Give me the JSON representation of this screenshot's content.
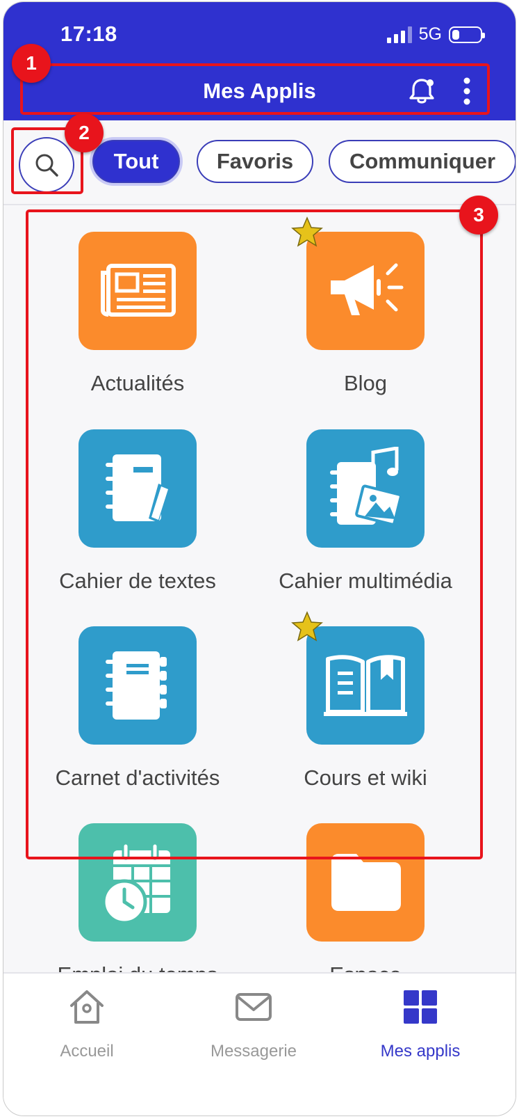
{
  "status": {
    "time": "17:18",
    "network": "5G"
  },
  "header": {
    "title": "Mes Applis"
  },
  "filters": [
    "Tout",
    "Favoris",
    "Communiquer"
  ],
  "apps": [
    {
      "label": "Actualités",
      "favorite": false
    },
    {
      "label": "Blog",
      "favorite": true
    },
    {
      "label": "Cahier de textes",
      "favorite": false
    },
    {
      "label": "Cahier multimédia",
      "favorite": false
    },
    {
      "label": "Carnet d'activités",
      "favorite": false
    },
    {
      "label": "Cours et wiki",
      "favorite": true
    },
    {
      "label": "Emploi du temps",
      "favorite": false
    },
    {
      "label": "Espace",
      "favorite": false
    }
  ],
  "bottom_nav": [
    {
      "label": "Accueil",
      "icon": "home-icon",
      "active": false
    },
    {
      "label": "Messagerie",
      "icon": "mail-icon",
      "active": false
    },
    {
      "label": "Mes applis",
      "icon": "apps-grid-icon",
      "active": true
    }
  ],
  "annotations": [
    "1",
    "2",
    "3"
  ],
  "colors": {
    "primary": "#2f31cf",
    "orange": "#fb8b2c",
    "blue": "#2f9ccb",
    "teal": "#4dbfab",
    "annotation": "#e8141c",
    "star": "#e6c21a"
  }
}
